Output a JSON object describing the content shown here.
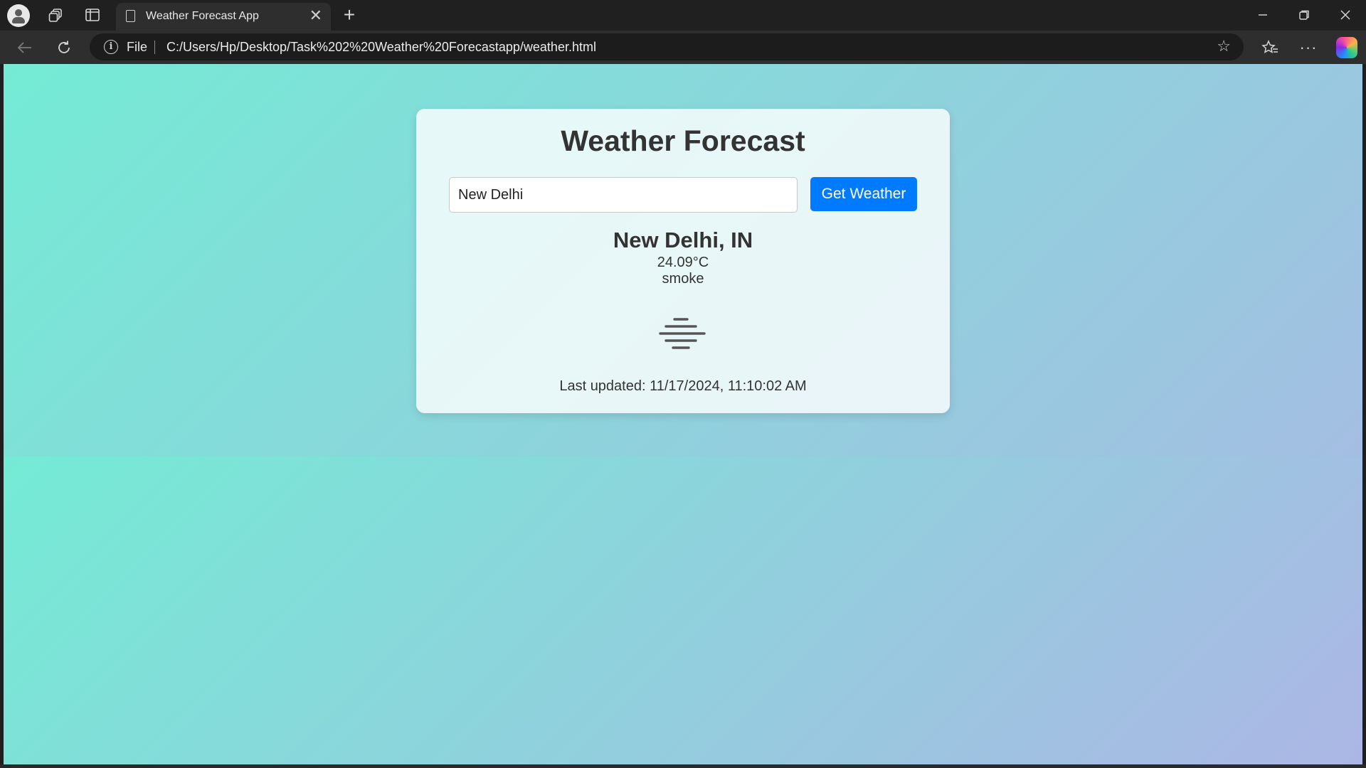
{
  "browser": {
    "tab_title": "Weather Forecast App",
    "tab_close": "✕",
    "new_tab": "+",
    "scheme_label": "File",
    "url": "C:/Users/Hp/Desktop/Task%202%20Weather%20Forecastapp/weather.html"
  },
  "app": {
    "heading": "Weather Forecast",
    "city_input_value": "New Delhi",
    "button_label": "Get Weather",
    "location": "New Delhi, IN",
    "temperature": "24.09°C",
    "description": "smoke",
    "weather_icon": "haze-smoke-icon",
    "last_updated": "Last updated: 11/17/2024, 11:10:02 AM"
  },
  "colors": {
    "gradient_start": "#74ebd5",
    "gradient_end": "#acb6e5",
    "button": "#007bff"
  }
}
